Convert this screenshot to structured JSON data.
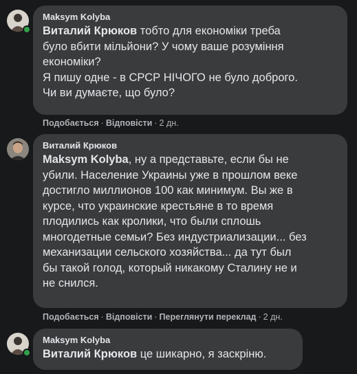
{
  "comments": [
    {
      "author": "Maksym Kolyba",
      "mention": "Виталий Крюков",
      "text_line1": " тобто для економіки треба",
      "text_lines": [
        "було вбити мільйони? У чому ваше розуміння",
        "економіки?",
        "Я пишу одне - в СРСР НІЧОГО не було доброго.",
        "Чи ви думаєте, що було?"
      ],
      "like_label": "Подобається",
      "reply_label": "Відповісти",
      "time": "2 дн."
    },
    {
      "author": "Виталий Крюков",
      "mention": "Maksym Kolyba",
      "text_line1": ", ну а представьте, если бы не",
      "text_lines": [
        "убили. Население Украины уже в прошлом веке",
        "достигло миллионов 100 как минимум. Вы же в",
        "курсе, что украинские крестьяне в то время",
        "плодились как кролики, что были сплошь",
        "многодетные семьи? Без индустриализации... без",
        "механизации сельского хозяйства... да тут был",
        "бы такой голод, который никакому Сталину не и",
        "не снился."
      ],
      "like_label": "Подобається",
      "reply_label": "Відповісти",
      "translate_label": "Переглянути переклад",
      "time": "2 дн."
    },
    {
      "author": "Maksym Kolyba",
      "mention": "Виталий Крюков",
      "text_line1": " це шикарно, я заскріню."
    }
  ]
}
